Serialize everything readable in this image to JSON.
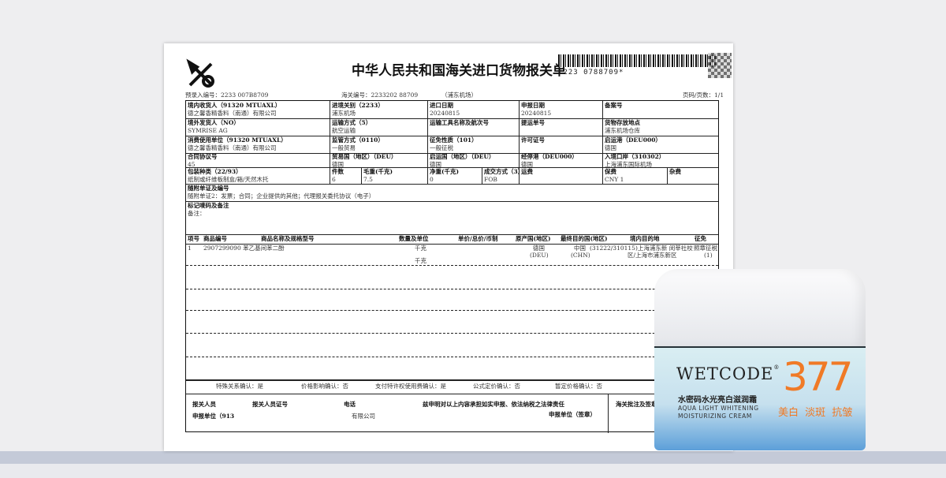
{
  "form": {
    "title": "中华人民共和国海关进口货物报关单",
    "barcode_text": "*223          0788709*",
    "pre_entry": "预录入编号：2233        007B8709",
    "customs_no": "海关编号：2233202        88709",
    "port_note": "（浦东机场）",
    "page": "页码/页数：1/1",
    "rows": [
      [
        [
          "境内收货人（91320        MTUAXL）",
          "德之馨香精香料（南通）有限公司"
        ],
        [
          "进境关别（2233）",
          "浦东机场"
        ],
        [
          "进口日期",
          "20240815"
        ],
        [
          "申报日期",
          "20240815"
        ],
        [
          "备案号",
          ""
        ]
      ],
      [
        [
          "境外发货人（NO）",
          "SYMRISE AG"
        ],
        [
          "运输方式（5）",
          "航空运输"
        ],
        [
          "运输工具名称及航次号",
          ""
        ],
        [
          "提运单号",
          ""
        ],
        [
          "货物存放地点",
          "浦东机场仓库"
        ]
      ],
      [
        [
          "消费使用单位（91320        MTUAXL）",
          "德之馨香精香料（南通）有限公司"
        ],
        [
          "监管方式（0110）",
          "一般贸易"
        ],
        [
          "征免性质（101）",
          "一般征税"
        ],
        [
          "许可证号",
          ""
        ],
        [
          "启运港（DEU000）",
          "德国"
        ]
      ],
      [
        [
          "合同协议号",
          "        45"
        ],
        [
          "贸易国（地区）（DEU）",
          "德国"
        ],
        [
          "启运国（地区）（DEU）",
          "德国"
        ],
        [
          "经停港（DEU000）",
          "德国"
        ],
        [
          "入境口岸（310302）",
          "上海浦东国际机场"
        ]
      ]
    ],
    "row5": [
      [
        "包装种类（22/93）",
        "纸制或纤维板制盒/箱/天然木托"
      ],
      [
        "件数",
        "6"
      ],
      [
        "毛重(千克)",
        "   7.5"
      ],
      [
        "净重(千克)",
        "   0"
      ],
      [
        "成交方式（3）",
        "FOB"
      ],
      [
        "运费",
        ""
      ],
      [
        "保费",
        "CNY    1"
      ],
      [
        "杂费",
        ""
      ]
    ],
    "docs_label": "随附单证及编号",
    "docs_value": "随附单证2：发票；合同；企业提供的其他；代理报关委托协议（电子）",
    "marks_label": "标记唛码及备注",
    "marks_value": "备注：",
    "item_headers": [
      "项号",
      "商品编号",
      "商品名称及规格型号",
      "数量及单位",
      "单价/总价/币制",
      "原产国(地区)",
      "最终目的国(地区)",
      "境内目的地",
      "征免"
    ],
    "item": {
      "no": "1",
      "code": "2907299090 苯乙基间苯二酚",
      "qty1": "   千克",
      "qty2": "   千克",
      "origin": "德国",
      "origin_code": "(DEU)",
      "dest": "中国",
      "dest_code": "(CHN)",
      "domestic": "(31222/310115)上海浦东新 闵莘社校",
      "domestic2": "区/上海市浦东新区",
      "levy": "照章征税",
      "levy2": "(1)"
    },
    "confirm": [
      "特殊关系确认：是",
      "价格影响确认：否",
      "支付特许权使用费确认：是",
      "公式定价确认：否",
      "暂定价格确认：否"
    ],
    "sign": {
      "person": "报关人员",
      "cert": "报关人员证号",
      "phone": "电话",
      "declare": "兹申明对以上内容承担如实申报、依法纳税之法律责任",
      "unit": "申报单位（913",
      "company": "有限公司",
      "stamp": "申报单位（签章）",
      "customs_sign": "海关批注及签章"
    }
  },
  "product": {
    "brand": "WETCODE",
    "reg": "®",
    "name_cn": "水密码水光亮白滋润霜",
    "name_en1": "AQUA LIGHT WHITENING",
    "name_en2": "MOISTURIZING CREAM",
    "number": "377",
    "tags": "美白 淡斑 抗皱"
  }
}
